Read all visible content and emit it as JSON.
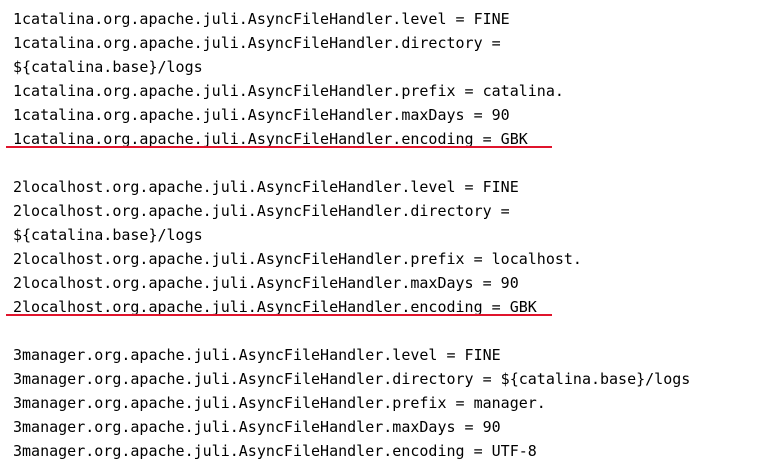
{
  "document": {
    "lines": [
      "1catalina.org.apache.juli.AsyncFileHandler.level = FINE",
      "1catalina.org.apache.juli.AsyncFileHandler.directory =",
      "${catalina.base}/logs",
      "1catalina.org.apache.juli.AsyncFileHandler.prefix = catalina.",
      "1catalina.org.apache.juli.AsyncFileHandler.maxDays = 90",
      "1catalina.org.apache.juli.AsyncFileHandler.encoding = GBK",
      "2localhost.org.apache.juli.AsyncFileHandler.level = FINE",
      "2localhost.org.apache.juli.AsyncFileHandler.directory =",
      "${catalina.base}/logs",
      "2localhost.org.apache.juli.AsyncFileHandler.prefix = localhost.",
      "2localhost.org.apache.juli.AsyncFileHandler.maxDays = 90",
      "2localhost.org.apache.juli.AsyncFileHandler.encoding = GBK",
      "3manager.org.apache.juli.AsyncFileHandler.level = FINE",
      "3manager.org.apache.juli.AsyncFileHandler.directory = ${catalina.base}/logs",
      "3manager.org.apache.juli.AsyncFileHandler.prefix = manager.",
      "3manager.org.apache.juli.AsyncFileHandler.maxDays = 90",
      "3manager.org.apache.juli.AsyncFileHandler.encoding = UTF-8"
    ]
  },
  "colors": {
    "text": "#000000",
    "underline": "#e0142c",
    "background": "#ffffff"
  }
}
